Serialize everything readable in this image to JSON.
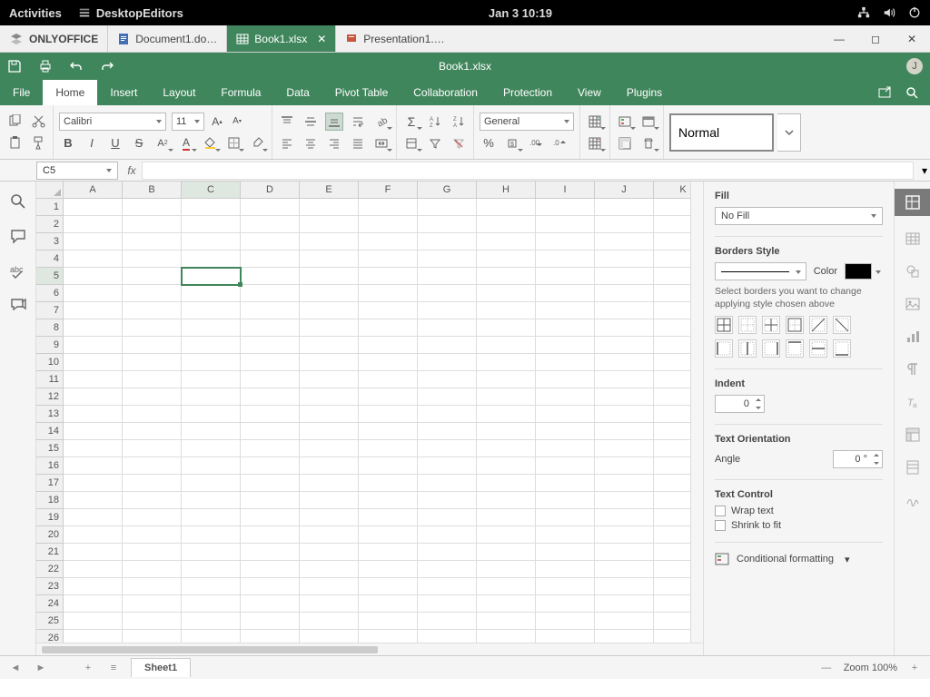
{
  "os": {
    "activities": "Activities",
    "app": "DesktopEditors",
    "clock": "Jan 3  10:19"
  },
  "brand": "ONLYOFFICE",
  "tabs": [
    {
      "label": "Document1.do…",
      "type": "doc"
    },
    {
      "label": "Book1.xlsx",
      "type": "sheet",
      "active": true
    },
    {
      "label": "Presentation1.…",
      "type": "slides"
    }
  ],
  "window_title": "Book1.xlsx",
  "user_initial": "J",
  "menubar": [
    "File",
    "Home",
    "Insert",
    "Layout",
    "Formula",
    "Data",
    "Pivot Table",
    "Collaboration",
    "Protection",
    "View",
    "Plugins"
  ],
  "active_menu": "Home",
  "ribbon": {
    "font_name": "Calibri",
    "font_size": "11",
    "number_format": "General",
    "style_name": "Normal"
  },
  "cell_ref": "C5",
  "grid": {
    "columns": [
      "A",
      "B",
      "C",
      "D",
      "E",
      "F",
      "G",
      "H",
      "I",
      "J",
      "K"
    ],
    "rows": 27,
    "active_col": "C",
    "active_row": 5
  },
  "right_panel": {
    "fill_label": "Fill",
    "fill_value": "No Fill",
    "borders_label": "Borders Style",
    "color_label": "Color",
    "borders_hint": "Select borders you want to change applying style chosen above",
    "indent_label": "Indent",
    "indent_value": "0",
    "orient_label": "Text Orientation",
    "angle_label": "Angle",
    "angle_value": "0 °",
    "textctrl_label": "Text Control",
    "wrap_label": "Wrap text",
    "shrink_label": "Shrink to fit",
    "condfmt_label": "Conditional formatting"
  },
  "sheet": {
    "name": "Sheet1"
  },
  "status": {
    "zoom": "Zoom 100%"
  }
}
